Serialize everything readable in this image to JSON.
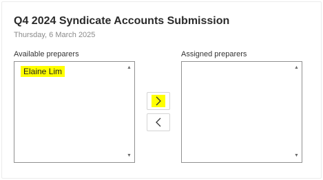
{
  "header": {
    "title": "Q4 2024 Syndicate Accounts Submission",
    "date": "Thursday, 6 March 2025"
  },
  "available": {
    "label": "Available preparers",
    "items": [
      {
        "name": "Elaine Lim",
        "highlighted": true
      }
    ]
  },
  "assigned": {
    "label": "Assigned preparers",
    "items": []
  },
  "controls": {
    "move_right_icon": "chevron-right-icon",
    "move_left_icon": "chevron-left-icon"
  },
  "colors": {
    "highlight": "#ffff00",
    "border": "#8f8f8f"
  }
}
